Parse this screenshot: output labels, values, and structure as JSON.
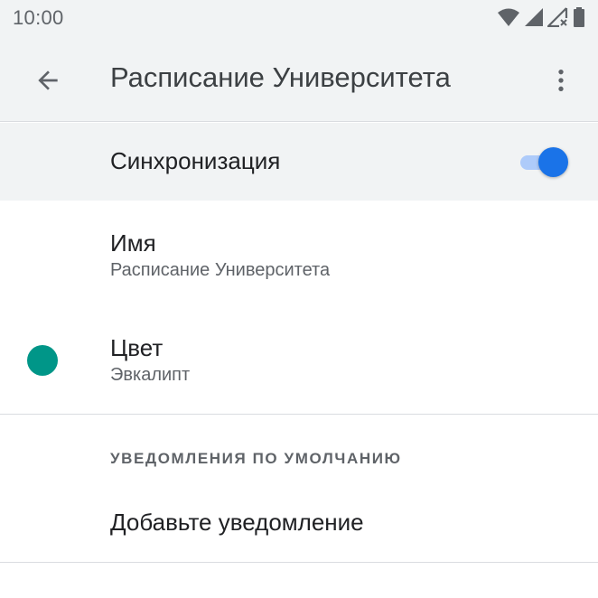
{
  "status_bar": {
    "time": "10:00",
    "icons": [
      "wifi-icon",
      "signal-icon",
      "no-data-signal-icon",
      "battery-icon"
    ]
  },
  "app_bar": {
    "back_icon": "arrow-back-icon",
    "title": "Расписание Университета",
    "more_icon": "more-vert-icon"
  },
  "sync": {
    "label": "Синхронизация",
    "enabled": true
  },
  "name_setting": {
    "label": "Имя",
    "value": "Расписание Университета"
  },
  "color_setting": {
    "label": "Цвет",
    "value": "Эвкалипт",
    "swatch": "#009688"
  },
  "notifications": {
    "section_title": "УВЕДОМЛЕНИЯ ПО УМОЛЧАНИЮ",
    "add_label": "Добавьте уведомление"
  },
  "colors": {
    "accent": "#1a73e8",
    "accent_track": "#aecbfa",
    "header_bg": "#f1f3f4"
  }
}
